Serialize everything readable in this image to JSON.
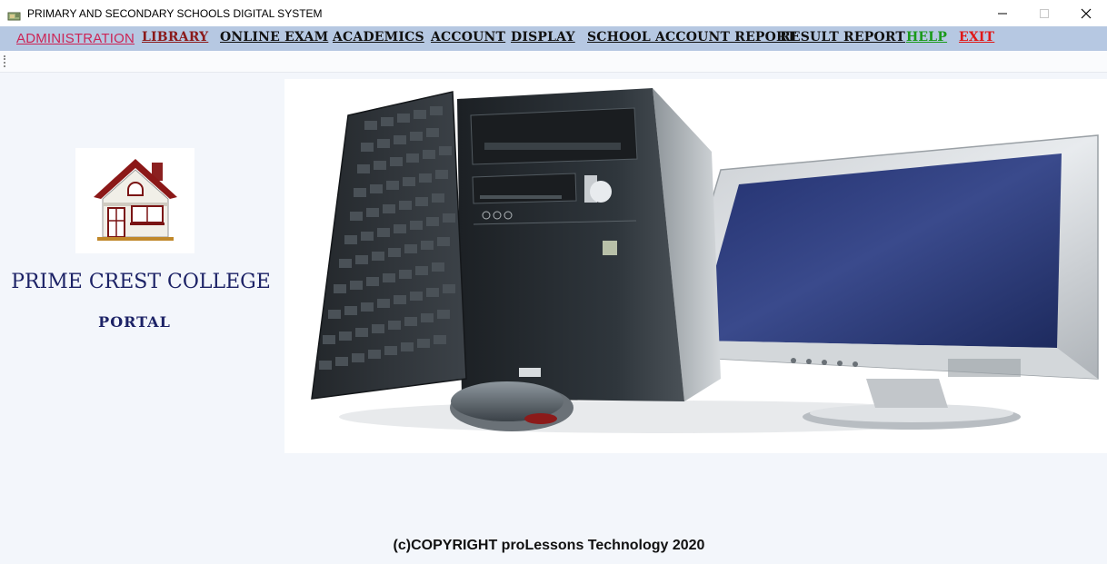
{
  "window": {
    "title": "PRIMARY AND SECONDARY SCHOOLS DIGITAL SYSTEM",
    "controls": [
      "minimize-icon",
      "maximize-icon",
      "close-icon"
    ]
  },
  "menu": {
    "administration": "ADMINISTRATION",
    "library": "LIBRARY",
    "online_exam": "ONLINE EXAM",
    "academics": "ACADEMICS",
    "account": "ACCOUNT",
    "display": "DISPLAY",
    "school_account_report": "SCHOOL ACCOUNT REPORT",
    "result_report": "RESULT REPORT",
    "help": "HELP",
    "exit": "EXIT"
  },
  "colors": {
    "menubar": "#b6c8e2",
    "administration": "#cc2455",
    "library": "#8b1a1a",
    "help": "#1a9a1a",
    "exit": "#e01818",
    "college_text": "#1c2266"
  },
  "main": {
    "logo_icon": "house-icon",
    "college_name": "PRIME CREST COLLEGE",
    "portal_label": "PORTAL",
    "hero_image": "desktop-computer-image"
  },
  "footer": {
    "copyright": "(c)COPYRIGHT proLessons Technology 2020"
  }
}
